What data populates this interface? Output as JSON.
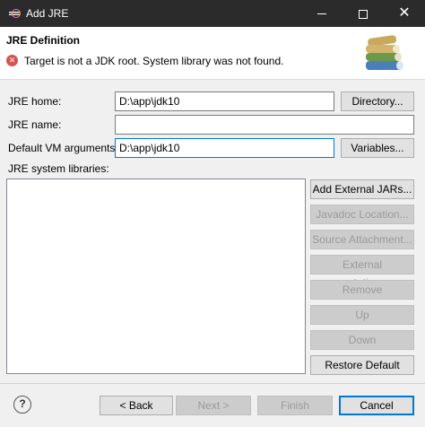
{
  "window": {
    "title": "Add JRE"
  },
  "header": {
    "title": "JRE Definition",
    "error_message": "Target is not a JDK root. System library was not found."
  },
  "form": {
    "jre_home_label": "JRE home:",
    "jre_home_value": "D:\\app\\jdk10",
    "jre_name_label": "JRE name:",
    "jre_name_value": "",
    "vm_args_label": "Default VM arguments:",
    "vm_args_value": "D:\\app\\jdk10",
    "directory_button": "Directory...",
    "variables_button": "Variables..."
  },
  "libraries": {
    "label": "JRE system libraries:",
    "buttons": {
      "add_external_jars": "Add External JARs...",
      "javadoc_location": "Javadoc Location...",
      "source_attachment": "Source Attachment...",
      "external_annotations": "External annotations...",
      "remove": "Remove",
      "up": "Up",
      "down": "Down",
      "restore_default": "Restore Default"
    }
  },
  "footer": {
    "help": "?",
    "back": "< Back",
    "next": "Next >",
    "finish": "Finish",
    "cancel": "Cancel"
  },
  "colors": {
    "error": "#d9534f",
    "focus": "#0078d7",
    "titlebar": "#2b2b2b"
  }
}
